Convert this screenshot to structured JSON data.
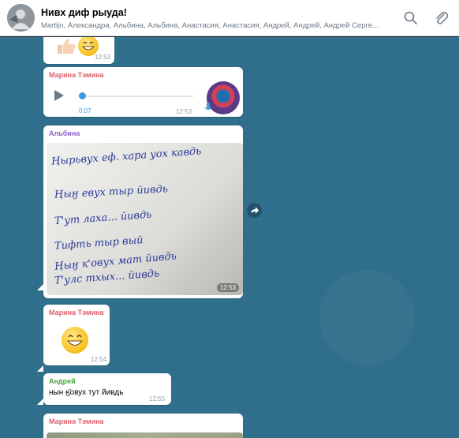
{
  "header": {
    "title": "Нивх диф рыуда!",
    "members": "Martijn, Александра, Альбина, Альбина, Анастасия, Анастасия, Андрей, Андрей, Андрей Серге...",
    "search_icon": "search-icon",
    "attach_icon": "paperclip-icon"
  },
  "messages": {
    "m1": {
      "time": "12:53"
    },
    "m2": {
      "sender": "Марина Тэмина",
      "duration": "0:07",
      "time": "12:53"
    },
    "m3": {
      "sender": "Альбина",
      "time": "12:53",
      "handwriting": [
        "Ңырьвух еф. хара уох кавдь",
        "Ңыӈ евух тыр йивдь",
        "Т'ут лаха... йивдь",
        "Тифть тыр вый",
        "Ңыӈ к'овух мат йивдь",
        "Т'улс тхых... йивдь"
      ]
    },
    "m4": {
      "sender": "Марина Тэмина",
      "time": "12:54"
    },
    "m5": {
      "sender": "Андрей",
      "text": "нын ӄ̆овух тут йивдь",
      "time": "12:55"
    },
    "m6": {
      "sender": "Марина Тэмина"
    }
  },
  "colors": {
    "sender_marina": "#e0606e",
    "sender_albina": "#8a63c8",
    "sender_andrey": "#47a83c",
    "chat_bg": "#2f6f8b"
  }
}
